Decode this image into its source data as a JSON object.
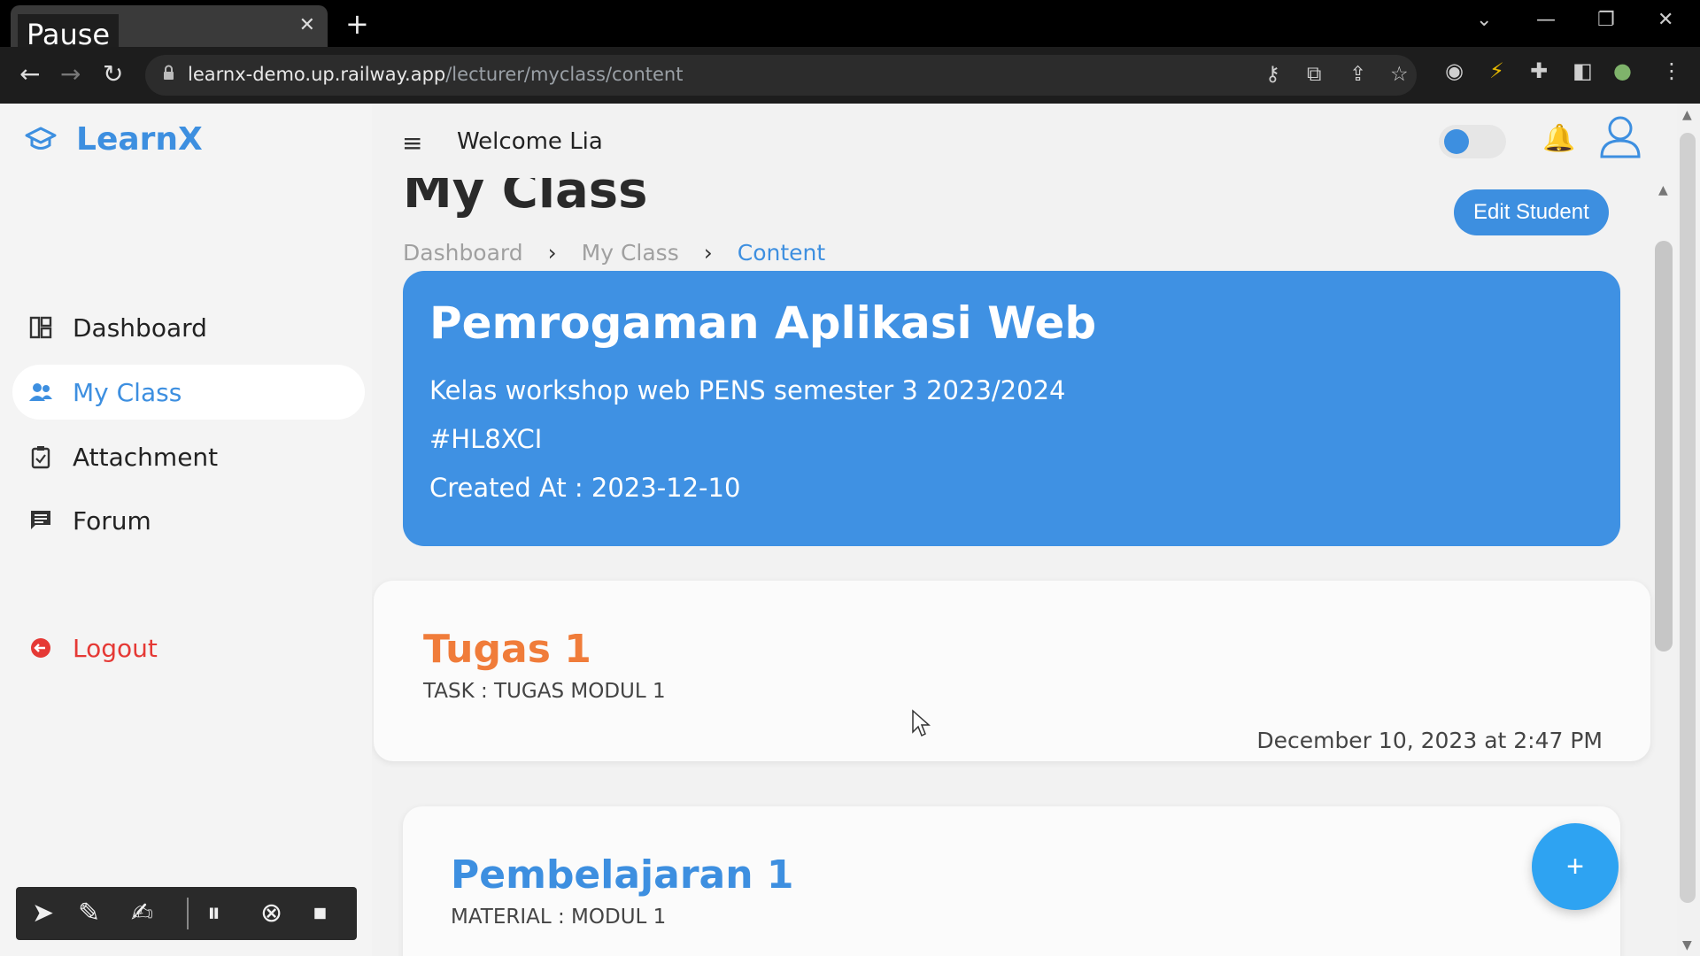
{
  "browser": {
    "tab_label": "Pause",
    "tab_close": "✕",
    "new_tab": "+",
    "url_host": "learnx-demo.up.railway.app",
    "url_path": "/lecturer/myclass/content"
  },
  "app": {
    "brand": "LearnX",
    "welcome": "Welcome Lia",
    "sidebar": [
      {
        "label": "Dashboard",
        "icon": "dashboard-icon"
      },
      {
        "label": "My Class",
        "icon": "group-icon"
      },
      {
        "label": "Attachment",
        "icon": "clipboard-icon"
      },
      {
        "label": "Forum",
        "icon": "chat-icon"
      }
    ],
    "logout": "Logout",
    "accent": "#3d8fe0"
  },
  "page": {
    "title": "My Class",
    "edit_button": "Edit Student",
    "breadcrumb": [
      "Dashboard",
      "My Class",
      "Content"
    ],
    "crumb_sep": "›"
  },
  "class_info": {
    "name": "Pemrogaman Aplikasi Web",
    "description": "Kelas workshop web PENS semester 3 2023/2024",
    "code": "#HL8XCI",
    "created": "Created At : 2023-12-10"
  },
  "items": [
    {
      "title": "Tugas 1",
      "subtitle": "TASK : TUGAS MODUL 1",
      "date": "December 10, 2023 at 2:47 PM"
    },
    {
      "title": "Pembelajaran 1",
      "subtitle": "MATERIAL : MODUL 1"
    }
  ],
  "fab": "+"
}
